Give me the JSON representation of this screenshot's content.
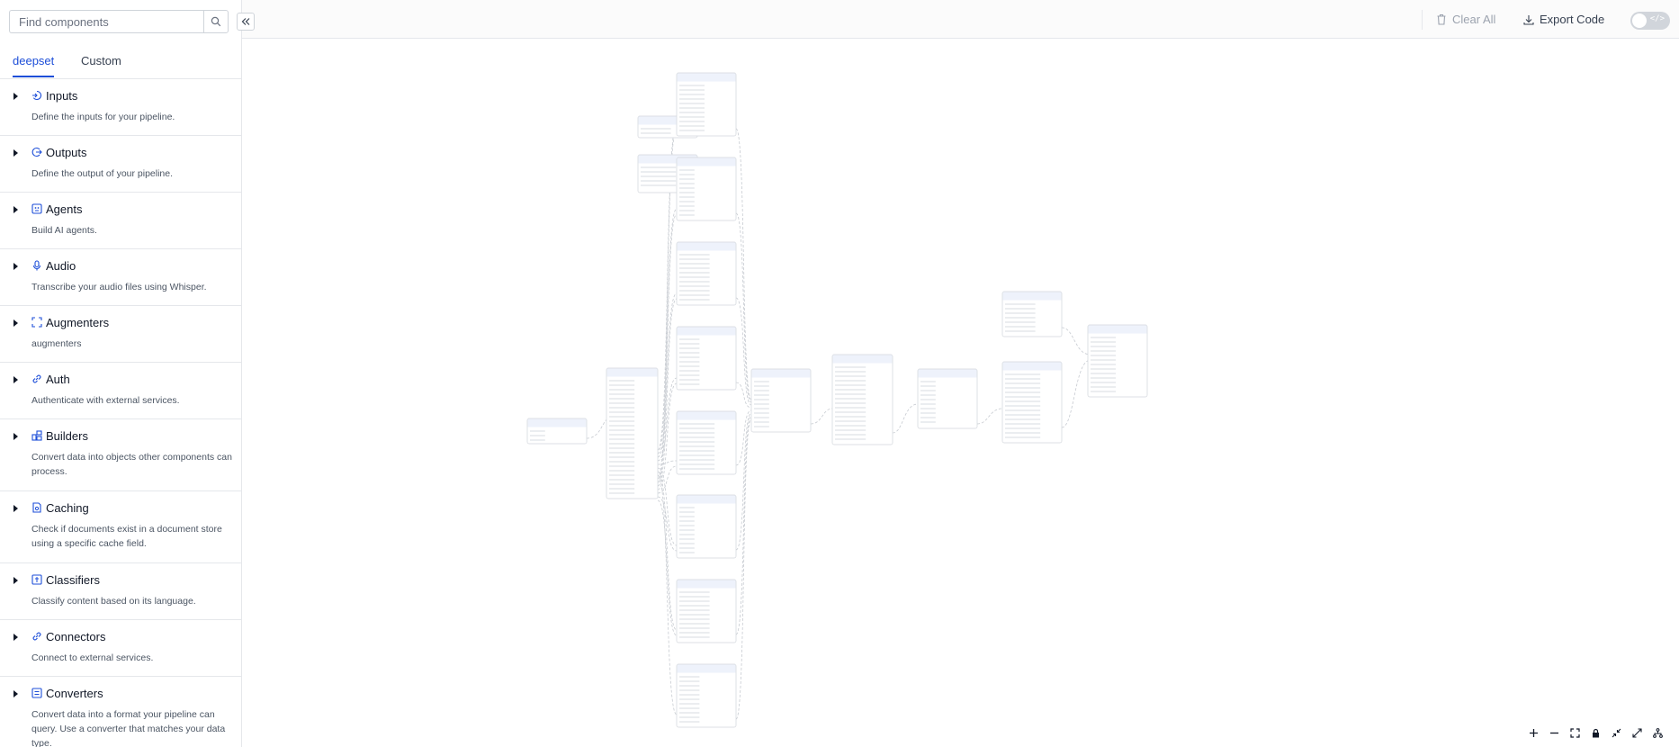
{
  "search": {
    "placeholder": "Find components"
  },
  "tabs": [
    {
      "label": "deepset",
      "active": true
    },
    {
      "label": "Custom",
      "active": false
    }
  ],
  "categories": [
    {
      "title": "Inputs",
      "description": "Define the inputs for your pipeline.",
      "icon": "inputs-icon"
    },
    {
      "title": "Outputs",
      "description": "Define the output of your pipeline.",
      "icon": "outputs-icon"
    },
    {
      "title": "Agents",
      "description": "Build AI agents.",
      "icon": "agents-icon"
    },
    {
      "title": "Audio",
      "description": "Transcribe your audio files using Whisper.",
      "icon": "microphone-icon"
    },
    {
      "title": "Augmenters",
      "description": "augmenters",
      "icon": "augmenters-icon"
    },
    {
      "title": "Auth",
      "description": "Authenticate with external services.",
      "icon": "link-icon"
    },
    {
      "title": "Builders",
      "description": "Convert data into objects other components can process.",
      "icon": "builders-icon"
    },
    {
      "title": "Caching",
      "description": "Check if documents exist in a document store using a specific cache field.",
      "icon": "caching-icon"
    },
    {
      "title": "Classifiers",
      "description": "Classify content based on its language.",
      "icon": "classifiers-icon"
    },
    {
      "title": "Connectors",
      "description": "Connect to external services.",
      "icon": "link-icon"
    },
    {
      "title": "Converters",
      "description": "Convert data into a format your pipeline can query. Use a converter that matches your data type.",
      "icon": "converters-icon"
    }
  ],
  "toolbar": {
    "clear_all": "Clear All",
    "export_code": "Export Code",
    "code_toggle_on": false,
    "colors": {
      "accent": "#1d4ed8",
      "muted": "#9ca3af"
    }
  },
  "controls": [
    "zoom-in-icon",
    "zoom-out-icon",
    "fit-view-icon",
    "lock-icon",
    "collapse-icon",
    "expand-icon",
    "layout-icon"
  ]
}
